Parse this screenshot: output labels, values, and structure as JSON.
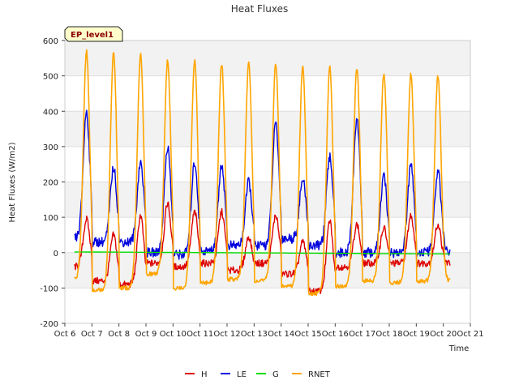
{
  "chart_data": {
    "type": "line",
    "title": "Heat Fluxes",
    "site_label": "EP_level1",
    "xlabel": "Time",
    "ylabel": "Heat Fluxes (W/m2)",
    "xlim": [
      6,
      21
    ],
    "ylim": [
      -200,
      600
    ],
    "x_ticks": [
      6,
      7,
      8,
      9,
      10,
      11,
      12,
      13,
      14,
      15,
      16,
      17,
      18,
      19,
      20,
      21
    ],
    "x_tick_labels": [
      "Oct 6",
      "Oct 7",
      "Oct 8",
      "Oct 9",
      "Oct 10",
      "Oct 11",
      "Oct 12",
      "Oct 13",
      "Oct 14",
      "Oct 15",
      "Oct 16",
      "Oct 17",
      "Oct 18",
      "Oct 19",
      "Oct 20",
      "Oct 21"
    ],
    "y_ticks": [
      -200,
      -100,
      0,
      100,
      200,
      300,
      400,
      500,
      600
    ],
    "y_tick_labels": [
      "-200",
      "-100",
      "0",
      "100",
      "200",
      "300",
      "400",
      "500",
      "600"
    ],
    "grid": true,
    "legend_position": "bottom-center",
    "x_start": 6.35,
    "x_end": 20.25,
    "peak_days": [
      6.8,
      7.8,
      8.8,
      9.8,
      10.8,
      11.8,
      12.8,
      13.8,
      14.8,
      15.8,
      16.8,
      17.8,
      18.8,
      19.8
    ],
    "series": [
      {
        "name": "H",
        "color": "#dd0000",
        "baseline": -30,
        "night": [
          -40,
          -80,
          -90,
          -30,
          -40,
          -30,
          -50,
          -30,
          -60,
          -110,
          -40,
          -30,
          -30,
          -30
        ],
        "peaks": [
          95,
          50,
          105,
          140,
          115,
          115,
          45,
          105,
          30,
          90,
          80,
          70,
          105,
          80
        ]
      },
      {
        "name": "LE",
        "color": "#0000dd",
        "baseline": 40,
        "night": [
          40,
          30,
          30,
          0,
          -5,
          5,
          20,
          20,
          40,
          20,
          0,
          0,
          0,
          0
        ],
        "peaks": [
          400,
          240,
          255,
          300,
          255,
          250,
          200,
          365,
          205,
          270,
          380,
          215,
          245,
          230
        ]
      },
      {
        "name": "G",
        "color": "#00dd00",
        "baseline": 0,
        "night": [
          0,
          0,
          0,
          0,
          0,
          0,
          0,
          0,
          0,
          0,
          0,
          0,
          0,
          0
        ],
        "peaks": [
          0,
          0,
          0,
          0,
          0,
          0,
          0,
          0,
          0,
          0,
          0,
          0,
          0,
          0
        ]
      },
      {
        "name": "RNET",
        "color": "#ffa500",
        "baseline": -75,
        "night": [
          -75,
          -105,
          -100,
          -60,
          -100,
          -85,
          -75,
          -80,
          -95,
          -115,
          -95,
          -80,
          -85,
          -80
        ],
        "peaks": [
          570,
          565,
          560,
          545,
          545,
          535,
          540,
          535,
          525,
          525,
          520,
          505,
          505,
          500
        ]
      }
    ]
  }
}
